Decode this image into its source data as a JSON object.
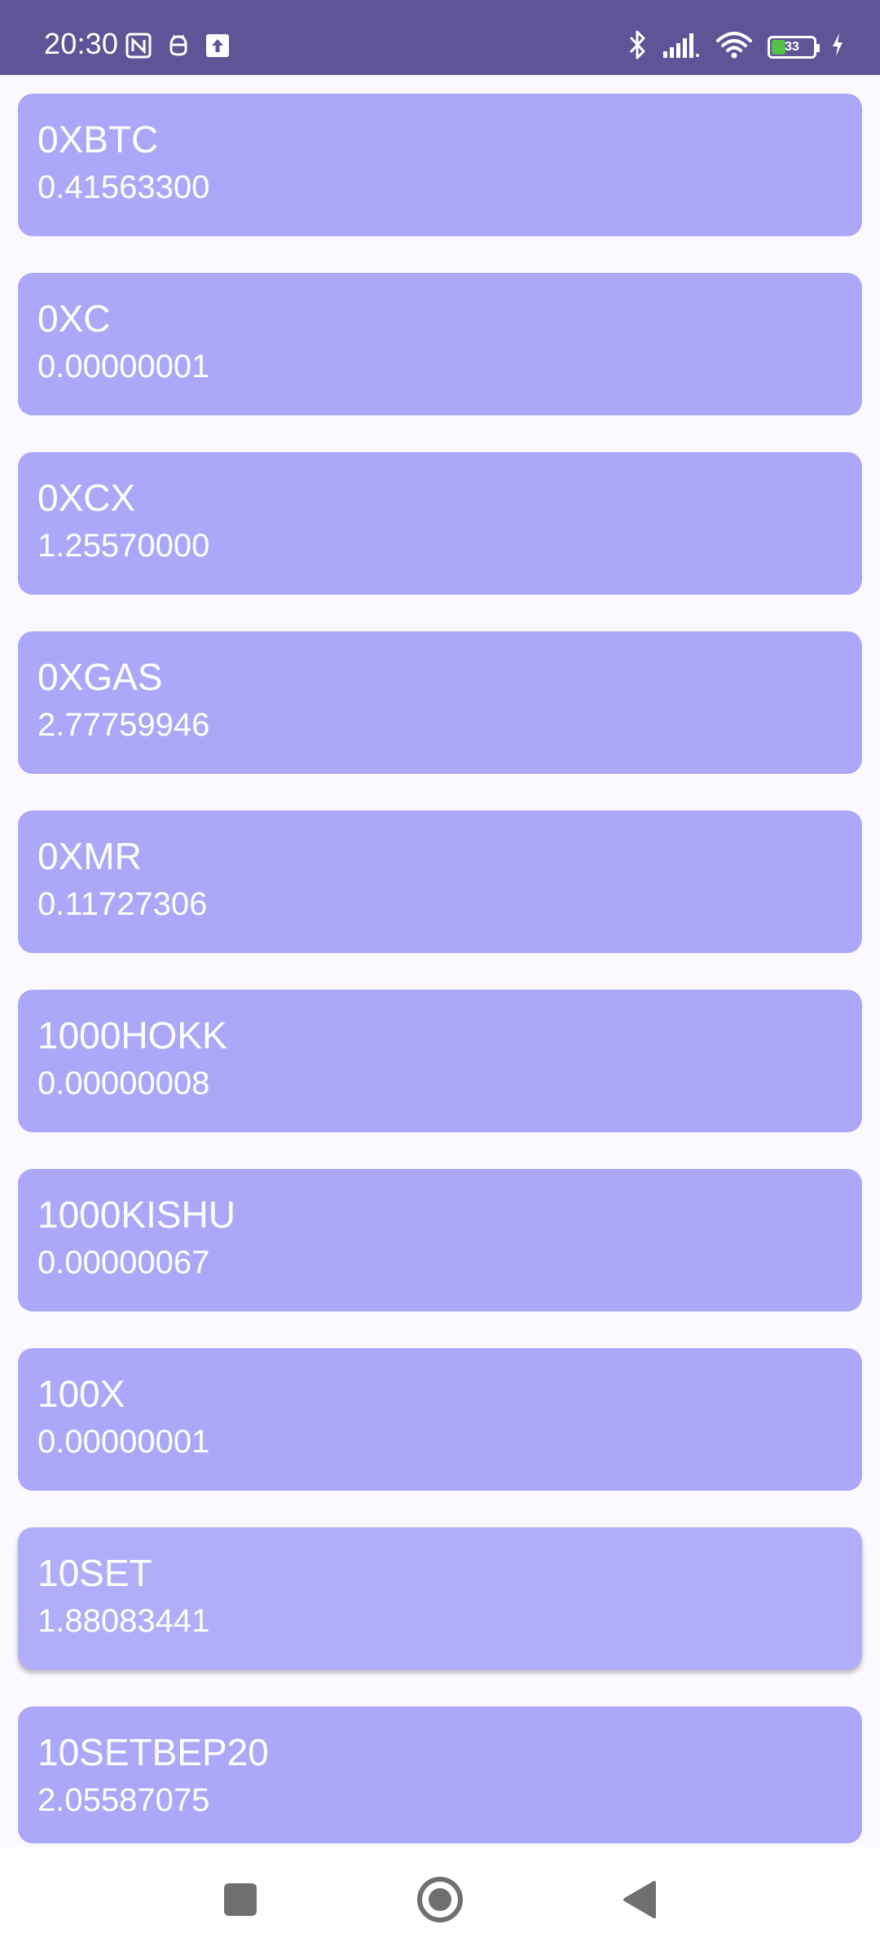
{
  "status_bar": {
    "time": "20:30",
    "battery_level": "33",
    "battery_fraction": 0.33,
    "background": "#5f5496"
  },
  "coins": [
    {
      "name": "0XBTC",
      "price": "0.41563300"
    },
    {
      "name": "0XC",
      "price": "0.00000001"
    },
    {
      "name": "0XCX",
      "price": "1.25570000"
    },
    {
      "name": "0XGAS",
      "price": "2.77759946"
    },
    {
      "name": "0XMR",
      "price": "0.11727306"
    },
    {
      "name": "1000HOKK",
      "price": "0.00000008"
    },
    {
      "name": "1000KISHU",
      "price": "0.00000067"
    },
    {
      "name": "100X",
      "price": "0.00000001"
    },
    {
      "name": "10SET",
      "price": "1.88083441"
    },
    {
      "name": "10SETBEP20",
      "price": "2.05587075"
    }
  ],
  "colors": {
    "card": "#aba8f9",
    "card_selected": "#b1aef9",
    "background": "#fbf8ff",
    "nav_icons": "#6f6f6f"
  },
  "icons": {
    "status_left": [
      "nfc-icon",
      "android-debug-icon",
      "upload-icon"
    ],
    "status_right": [
      "bluetooth-icon",
      "signal-icon",
      "wifi-icon",
      "battery-icon",
      "charging-icon"
    ],
    "nav": [
      "recents-icon",
      "home-icon",
      "back-icon"
    ]
  }
}
